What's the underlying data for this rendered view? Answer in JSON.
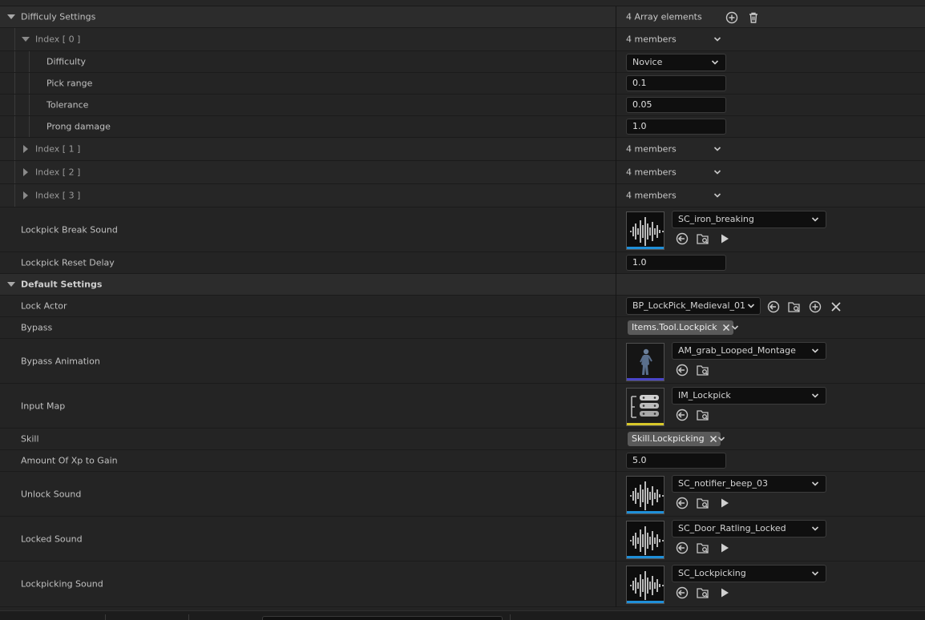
{
  "difficulty_settings": {
    "label": "Difficuly Settings",
    "summary": "4 Array elements",
    "index0": {
      "label": "Index [ 0 ]",
      "summary": "4 members",
      "difficulty": {
        "label": "Difficulty",
        "value": "Novice"
      },
      "pick_range": {
        "label": "Pick range",
        "value": "0.1"
      },
      "tolerance": {
        "label": "Tolerance",
        "value": "0.05"
      },
      "prong_damage": {
        "label": "Prong damage",
        "value": "1.0"
      }
    },
    "index1": {
      "label": "Index [ 1 ]",
      "summary": "4 members"
    },
    "index2": {
      "label": "Index [ 2 ]",
      "summary": "4 members"
    },
    "index3": {
      "label": "Index [ 3 ]",
      "summary": "4 members"
    }
  },
  "lockpick_break_sound": {
    "label": "Lockpick Break Sound",
    "value": "SC_iron_breaking"
  },
  "lockpick_reset_delay": {
    "label": "Lockpick Reset Delay",
    "value": "1.0"
  },
  "default_settings": {
    "label": "Default Settings",
    "lock_actor": {
      "label": "Lock Actor",
      "value": "BP_LockPick_Medieval_01"
    },
    "bypass": {
      "label": "Bypass",
      "tag": "Items.Tool.Lockpick"
    },
    "bypass_animation": {
      "label": "Bypass Animation",
      "value": "AM_grab_Looped_Montage"
    },
    "input_map": {
      "label": "Input Map",
      "value": "IM_Lockpick"
    },
    "skill": {
      "label": "Skill",
      "tag": "Skill.Lockpicking"
    },
    "amount_xp": {
      "label": "Amount Of Xp to Gain",
      "value": "5.0"
    },
    "unlock_sound": {
      "label": "Unlock Sound",
      "value": "SC_notifier_beep_03"
    },
    "locked_sound": {
      "label": "Locked Sound",
      "value": "SC_Door_Ratling_Locked"
    },
    "lockpicking_sound": {
      "label": "Lockpicking Sound",
      "value": "SC_Lockpicking"
    }
  },
  "colors": {
    "panel_bg": "#242424",
    "category_bg": "#2c2c2c",
    "input_bg": "#0f0f0f",
    "sound_accent": "#1f8fd8",
    "anim_accent": "#4a45c8",
    "input_map_accent": "#d8c82a",
    "tag_bg": "#5a5a5a"
  },
  "icons": [
    "expand-triangle-icon",
    "collapse-triangle-icon",
    "add-element-icon",
    "delete-icon",
    "chevron-down-icon",
    "use-selected-icon",
    "browse-icon",
    "play-icon",
    "clear-icon",
    "waveform-icon"
  ]
}
